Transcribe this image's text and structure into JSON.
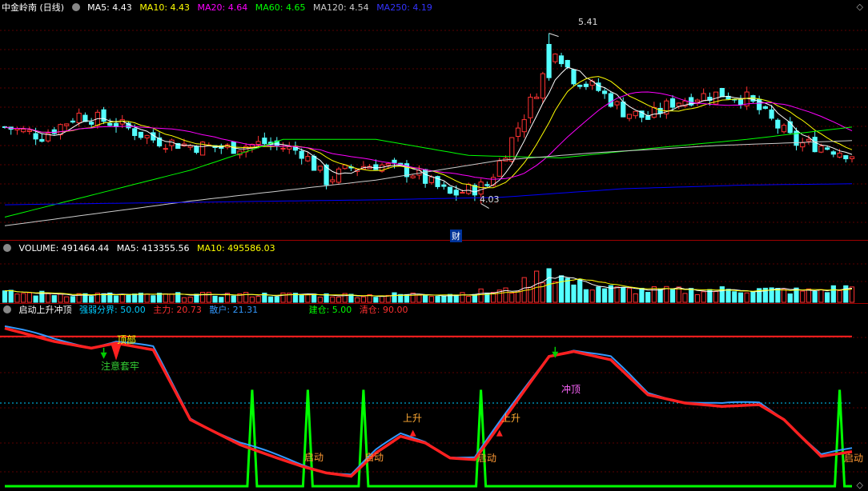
{
  "panels": {
    "price": {
      "title": "中金岭南 (日线)",
      "indicators": [
        {
          "label": "MA5: 4.43",
          "color": "#ffffff"
        },
        {
          "label": "MA10: 4.43",
          "color": "#ffff00"
        },
        {
          "label": "MA20: 4.64",
          "color": "#ff00ff"
        },
        {
          "label": "MA60: 4.65",
          "color": "#00ff00"
        },
        {
          "label": "MA120: 4.54",
          "color": "#cccccc"
        },
        {
          "label": "MA250: 4.19",
          "color": "#0000ff"
        }
      ],
      "annotations": {
        "high": "5.41",
        "low": "4.03",
        "cai": "财"
      }
    },
    "volume": {
      "indicators": [
        {
          "label": "VOLUME: 491464.44",
          "color": "#ffffff"
        },
        {
          "label": "MA5: 413355.56",
          "color": "#ffffff"
        },
        {
          "label": "MA10: 495586.03",
          "color": "#ffff00"
        }
      ]
    },
    "signal": {
      "title": "启动上升冲顶",
      "indicators": [
        {
          "label": "强弱分界: 50.00",
          "color": "#00ccff"
        },
        {
          "label": "主力: 20.73",
          "color": "#ff3030"
        },
        {
          "label": "散户: 21.31",
          "color": "#3399ff"
        },
        {
          "label": "建仓: 5.00",
          "color": "#00ff00"
        },
        {
          "label": "清仓: 90.00",
          "color": "#ff3030"
        }
      ],
      "annotations": {
        "top": "顶部",
        "caution": "注意套牢",
        "start1": "启动",
        "start2": "启动",
        "start3": "启动",
        "start4": "启动",
        "rise1": "上升",
        "rise2": "上升",
        "peak": "冲顶"
      }
    }
  },
  "controls": {
    "gear": "⚙",
    "diamond_top": "◇",
    "diamond_bottom": "◇"
  },
  "chart_data": [
    {
      "type": "line",
      "name": "price",
      "ylim": [
        3.8,
        5.55
      ],
      "count": 138,
      "series": [
        {
          "name": "MA5",
          "color": "#ffffff"
        },
        {
          "name": "MA10",
          "color": "#ffff00"
        },
        {
          "name": "MA20",
          "color": "#ff00ff"
        },
        {
          "name": "MA60",
          "color": "#00ff00"
        },
        {
          "name": "MA120",
          "color": "#cccccc"
        },
        {
          "name": "MA250",
          "color": "#0000ff"
        }
      ],
      "close_anchors": [
        [
          0,
          4.65
        ],
        [
          6,
          4.58
        ],
        [
          12,
          4.75
        ],
        [
          18,
          4.68
        ],
        [
          24,
          4.55
        ],
        [
          30,
          4.5
        ],
        [
          36,
          4.48
        ],
        [
          42,
          4.52
        ],
        [
          48,
          4.45
        ],
        [
          52,
          4.22
        ],
        [
          56,
          4.32
        ],
        [
          60,
          4.35
        ],
        [
          66,
          4.28
        ],
        [
          72,
          4.1
        ],
        [
          78,
          4.18
        ],
        [
          82,
          4.55
        ],
        [
          86,
          4.95
        ],
        [
          89,
          5.3
        ],
        [
          92,
          5.05
        ],
        [
          96,
          4.95
        ],
        [
          100,
          4.78
        ],
        [
          104,
          4.72
        ],
        [
          108,
          4.85
        ],
        [
          112,
          4.9
        ],
        [
          116,
          4.92
        ],
        [
          120,
          4.88
        ],
        [
          124,
          4.7
        ],
        [
          128,
          4.52
        ],
        [
          132,
          4.5
        ],
        [
          137,
          4.43
        ]
      ]
    },
    {
      "type": "bar",
      "name": "volume",
      "ylim": [
        0,
        1500000
      ],
      "volume_anchors": [
        [
          0,
          300000
        ],
        [
          20,
          230000
        ],
        [
          40,
          250000
        ],
        [
          60,
          230000
        ],
        [
          72,
          280000
        ],
        [
          82,
          380000
        ],
        [
          88,
          1050000
        ],
        [
          92,
          600000
        ],
        [
          100,
          400000
        ],
        [
          110,
          380000
        ],
        [
          120,
          420000
        ],
        [
          130,
          360000
        ],
        [
          137,
          491464
        ]
      ]
    },
    {
      "type": "line",
      "name": "signal",
      "ylim": [
        0,
        100
      ],
      "series": [
        {
          "name": "主力",
          "color": "#ff2020"
        },
        {
          "name": "散户",
          "color": "#3399ff"
        },
        {
          "name": "强弱分界",
          "color": "#00ccff"
        },
        {
          "name": "建仓",
          "color": "#00ff00"
        },
        {
          "name": "清仓",
          "color": "#ff3030"
        }
      ],
      "mainforce_anchors": [
        [
          0,
          95
        ],
        [
          8,
          87
        ],
        [
          14,
          83
        ],
        [
          18,
          86
        ],
        [
          24,
          82
        ],
        [
          30,
          40
        ],
        [
          38,
          25
        ],
        [
          44,
          17
        ],
        [
          48,
          12
        ],
        [
          52,
          8
        ],
        [
          56,
          6
        ],
        [
          60,
          20
        ],
        [
          64,
          30
        ],
        [
          68,
          26
        ],
        [
          72,
          17
        ],
        [
          76,
          16
        ],
        [
          82,
          47
        ],
        [
          88,
          78
        ],
        [
          92,
          81
        ],
        [
          98,
          76
        ],
        [
          104,
          55
        ],
        [
          110,
          50
        ],
        [
          116,
          48
        ],
        [
          122,
          49
        ],
        [
          126,
          40
        ],
        [
          132,
          18
        ],
        [
          137,
          20.73
        ]
      ],
      "spike_positions": [
        40,
        49,
        58,
        77,
        135
      ]
    }
  ]
}
